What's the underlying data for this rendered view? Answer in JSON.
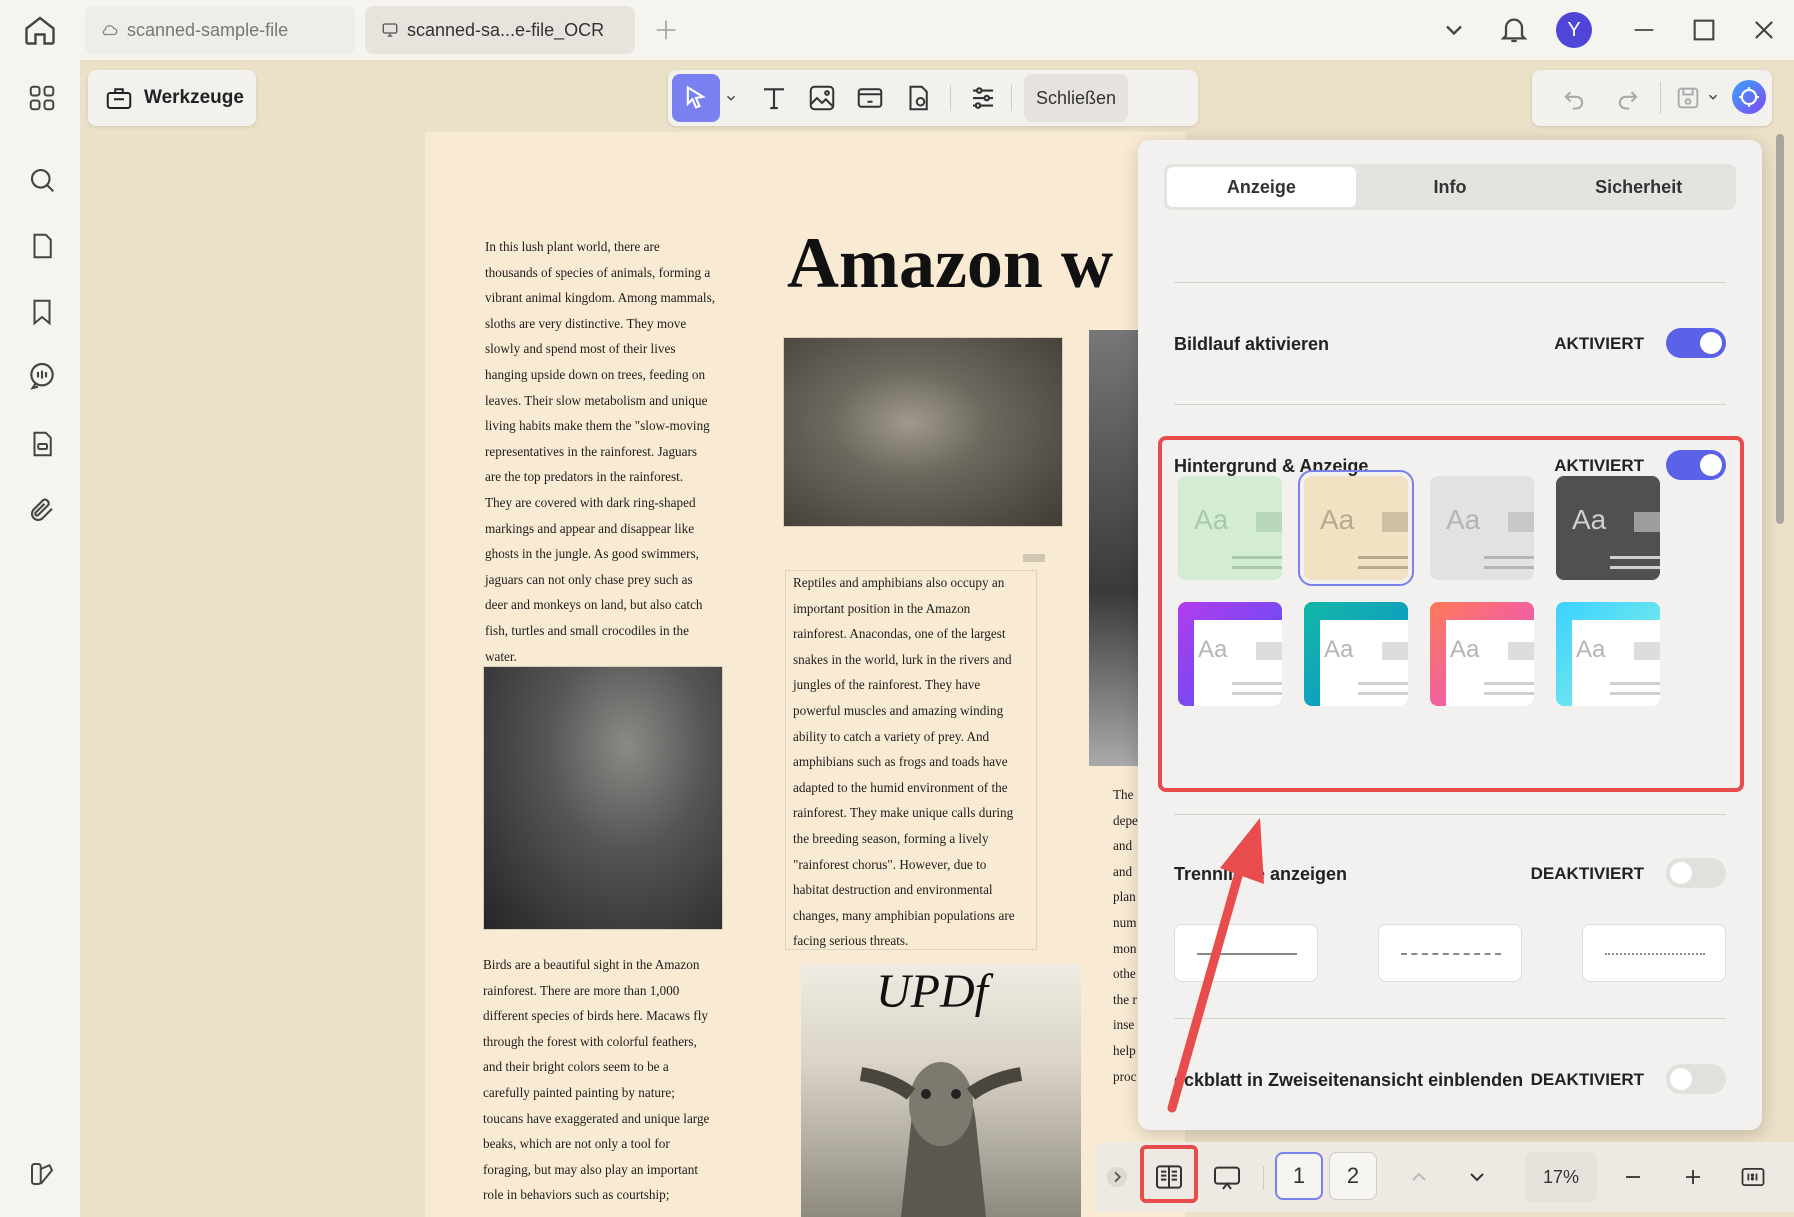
{
  "tabs": [
    {
      "label": "scanned-sample-file",
      "icon": "cloud-icon"
    },
    {
      "label": "scanned-sa...e-file_OCR",
      "icon": "monitor-icon"
    }
  ],
  "user": {
    "avatar_initial": "Y"
  },
  "toolbar": {
    "werkzeuge": "Werkzeuge",
    "close": "Schließen"
  },
  "document": {
    "title_fragment": "Amazon w",
    "col1_para1": [
      "In this lush plant world, there are",
      "thousands of species of animals, forming a",
      "vibrant animal kingdom. Among mammals,",
      "sloths are very distinctive. They move",
      "slowly and spend most of their lives",
      "hanging upside down on trees, feeding on",
      "leaves. Their slow metabolism and unique",
      "living habits make them the \"slow-moving",
      "representatives in the rainforest. Jaguars",
      "are the top predators in the rainforest.",
      "They are covered with dark ring-shaped",
      "markings and appear and disappear like",
      "ghosts in the jungle. As good swimmers,",
      "jaguars can not only chase prey such as",
      "deer and monkeys on land, but also catch",
      "fish, turtles and small crocodiles in the",
      "water."
    ],
    "col1_para2": [
      "Birds are a beautiful sight in the Amazon",
      "rainforest. There are more than 1,000",
      "different species of birds here. Macaws fly",
      "through the forest with colorful feathers,",
      "and their bright colors seem to be a",
      "carefully painted painting by nature;",
      "toucans have exaggerated and unique large",
      "beaks, which are not only a tool for",
      "foraging, but may also play an important",
      "role in behaviors such as courtship;"
    ],
    "col2_para": [
      "Reptiles and amphibians also occupy an",
      "important position in the Amazon",
      "rainforest. Anacondas, one of the largest",
      "snakes in the world, lurk in the rivers and",
      "jungles of the rainforest. They have",
      "powerful muscles and amazing winding",
      "ability to catch a variety of prey. And",
      "amphibians such as frogs and toads have",
      "adapted to the humid environment of the",
      "rainforest. They make unique calls during",
      "the breeding season, forming a lively",
      "\"rainforest chorus\". However, due to",
      "habitat destruction and environmental",
      "changes, many amphibian populations are",
      "facing serious threats."
    ],
    "col3_fragments": [
      "The",
      "depe",
      "and",
      "and",
      "plan",
      "num",
      "mon",
      "othe",
      "the r",
      "inse",
      "help",
      "proc"
    ],
    "logo_text": "UPDf"
  },
  "panel": {
    "tabs": [
      {
        "label": "Anzeige",
        "active": true
      },
      {
        "label": "Info",
        "active": false
      },
      {
        "label": "Sicherheit",
        "active": false
      }
    ],
    "scroll": {
      "label": "Bildlauf aktivieren",
      "state": "AKTIVIERT",
      "on": true
    },
    "background": {
      "label": "Hintergrund & Anzeige",
      "state": "AKTIVIERT",
      "on": true
    },
    "themes": [
      {
        "bg": "#d3ecd2",
        "fg": "#a9c9a8",
        "selected": false
      },
      {
        "bg": "#f1e2c4",
        "fg": "#b8aa8e",
        "selected": true
      },
      {
        "bg": "#e2e2e2",
        "fg": "#b5b5b5",
        "selected": false
      },
      {
        "bg": "#505050",
        "fg": "#d0d0d0",
        "selected": false
      },
      {
        "bg": "linear-gradient(135deg,#b23cf0,#4c52f2)",
        "fg": "#b5b5b5",
        "selected": false
      },
      {
        "bg": "linear-gradient(135deg,#12b8a6,#0f8fd0)",
        "fg": "#b5b5b5",
        "selected": false
      },
      {
        "bg": "linear-gradient(135deg,#ff7a59,#e64bd9)",
        "fg": "#b5b5b5",
        "selected": false
      },
      {
        "bg": "linear-gradient(135deg,#3ad1ff,#8ef2e4)",
        "fg": "#b5b5b5",
        "selected": false
      }
    ],
    "theme_sample": "Aa",
    "separator": {
      "label_left": "Trennli",
      "label_right": "e anzeigen",
      "state": "DEAKTIVIERT",
      "on": false
    },
    "cover": {
      "label": "eckblatt in Zweiseitenansicht einblenden",
      "state": "DEAKTIVIERT",
      "on": false
    }
  },
  "bottombar": {
    "pages": [
      "1",
      "2"
    ],
    "current_page": "1",
    "zoom": "17%"
  },
  "colors": {
    "accent": "#5b62e8",
    "highlight": "#e84c4c",
    "page": "#f9ebd3"
  }
}
